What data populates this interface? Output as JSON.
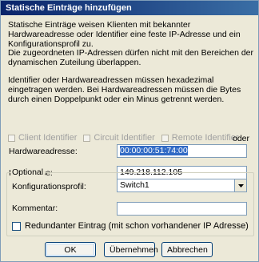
{
  "window": {
    "title": "Statische Einträge hinzufügen"
  },
  "description": {
    "p1": "Statische Einträge weisen Klienten mit bekannter Hardwareadresse oder Identifier eine feste IP-Adresse und ein Konfigurationsprofil zu.",
    "p2": "Die zugeordneten IP-Adressen dürfen nicht mit den Bereichen der dynamischen Zuteilung überlappen.",
    "p3": "Identifier oder Hardwareadressen müssen hexadezimal eingetragen werden. Bei Hardwareadressen müssen die Bytes durch einen Doppelpunkt oder ein Minus getrennt werden."
  },
  "identifier_options": {
    "client": "Client Identifier",
    "circuit": "Circuit Identifier",
    "remote": "Remote Identifier",
    "oder": "oder"
  },
  "hardware": {
    "label": "Hardwareadresse:",
    "value": "00:00:00:51:74:00"
  },
  "ip": {
    "label": "IP-Adresse:",
    "value": "149.218.112.105"
  },
  "optional": {
    "legend": "Optional",
    "profile_label": "Konfigurationsprofil:",
    "profile_value": "Switch1",
    "comment_label": "Kommentar:",
    "comment_value": "",
    "redundant_label": "Redundanter Eintrag (mit schon vorhandener IP Adresse)"
  },
  "buttons": {
    "ok": "OK",
    "apply": "Übernehmen",
    "cancel": "Abbrechen"
  }
}
